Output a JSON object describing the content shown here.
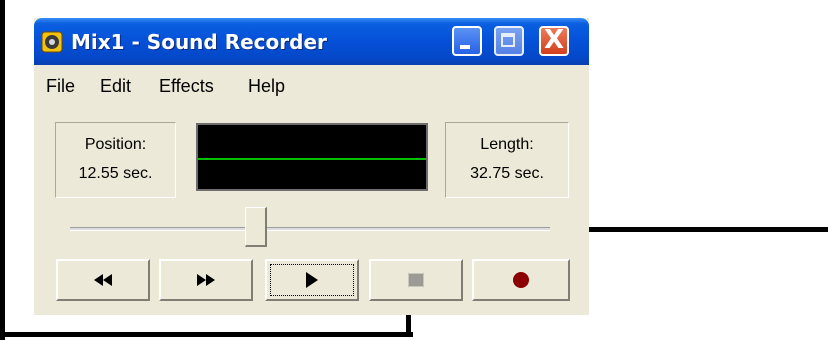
{
  "window": {
    "title": "Mix1 - Sound Recorder",
    "close_glyph": "X",
    "icons": {
      "app": "sound-recorder-icon",
      "minimize": "minimize-icon",
      "maximize": "maximize-icon",
      "close": "close-icon"
    }
  },
  "menu": [
    "File",
    "Edit",
    "Effects",
    "Help"
  ],
  "position": {
    "label": "Position:",
    "value": "12.55 sec."
  },
  "length": {
    "label": "Length:",
    "value": "32.75 sec."
  },
  "slider": {
    "position_fraction": 0.383
  },
  "transport": {
    "icons": [
      "rewind-icon",
      "fast-forward-icon",
      "play-icon",
      "stop-icon",
      "record-icon"
    ]
  },
  "colors": {
    "title_bar": "#0550d8",
    "waveform": "#00c000",
    "record": "#8b0000",
    "close_button": "#d2401e"
  }
}
